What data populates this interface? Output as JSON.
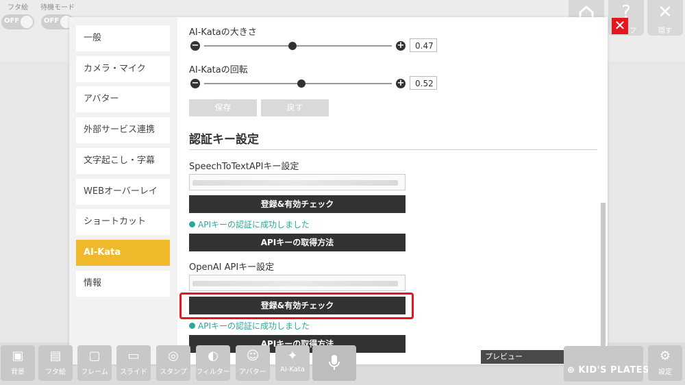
{
  "top_left": {
    "toggles": [
      {
        "label": "フタ絵",
        "state": "OFF"
      },
      {
        "label": "待機モード",
        "state": "OFF"
      }
    ]
  },
  "top_right": {
    "help_glyph": "?",
    "help_label": "ヘルプ",
    "hide_glyph": "✕",
    "hide_label": "隠す"
  },
  "close_glyph": "✕",
  "sidebar": {
    "items": [
      {
        "label": "一般"
      },
      {
        "label": "カメラ・マイク"
      },
      {
        "label": "アバター"
      },
      {
        "label": "外部サービス連携"
      },
      {
        "label": "文字起こし・字幕"
      },
      {
        "label": "WEBオーバーレイ"
      },
      {
        "label": "ショートカット"
      },
      {
        "label": "AI-Kata"
      },
      {
        "label": "情報"
      }
    ],
    "active_index": 7
  },
  "content": {
    "size_label": "AI-Kataの大きさ",
    "size_value": "0.47",
    "size_fraction": 0.47,
    "rotation_label": "AI-Kataの回転",
    "rotation_value": "0.52",
    "rotation_fraction": 0.52,
    "save_label": "保存",
    "revert_label": "戻す",
    "auth_heading": "認証キー設定",
    "stt": {
      "label": "SpeechToTextAPIキー設定",
      "register_label": "登録&有効チェック",
      "success_text": "APIキーの認証に成功しました",
      "howto_label": "APIキーの取得方法"
    },
    "openai": {
      "label": "OpenAI APIキー設定",
      "register_label": "登録&有効チェック",
      "success_text": "APIキーの認証に成功しました",
      "howto_label": "APIキーの取得方法"
    }
  },
  "preview": {
    "label": "プレビュー",
    "chevron": "^"
  },
  "toolbar": {
    "items": [
      {
        "label": "背景",
        "icon": "background-icon"
      },
      {
        "label": "フタ絵",
        "icon": "cover-icon"
      },
      {
        "label": "フレーム",
        "icon": "frame-icon"
      },
      {
        "label": "スライド",
        "icon": "slide-icon"
      },
      {
        "label": "スタンプ",
        "icon": "stamp-icon"
      },
      {
        "label": "フィルター",
        "icon": "filter-icon"
      },
      {
        "label": "アバター",
        "icon": "avatar-icon"
      },
      {
        "label": "AI-Kata",
        "icon": "ai-kata-icon"
      }
    ],
    "settings_label": "設定",
    "brand": "KID'S PLATES"
  },
  "colors": {
    "accent": "#f0b92c",
    "success": "#2aa89a",
    "highlight": "#e5161e",
    "dark_button": "#333333"
  }
}
